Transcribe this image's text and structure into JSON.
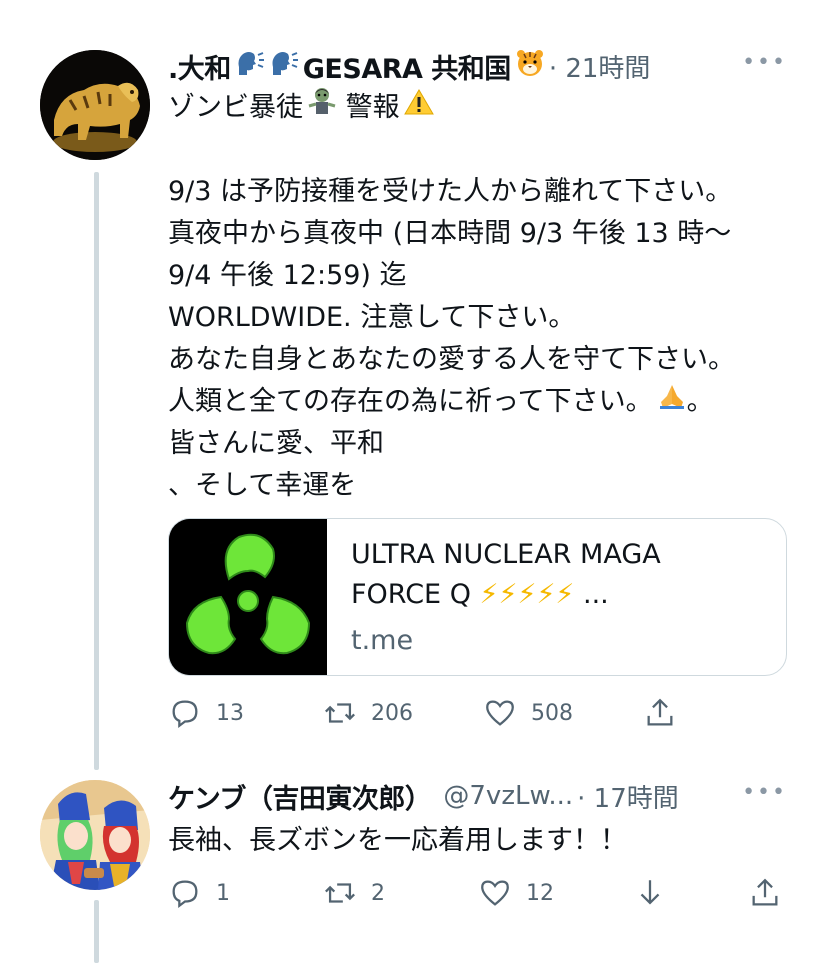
{
  "tweet1": {
    "name": ".大和",
    "name_mid": "GESARA 共和国",
    "time": "· 21時間",
    "lines": [
      "ゾンビ暴徒",
      "9/3 は予防接種を受けた人から離れて下さい。",
      "真夜中から真夜中 (日本時間 9/3 午後 13 時〜",
      "9/4 午後 12:59) 迄",
      "WORLDWIDE. 注意して下さい。",
      "あなた自身とあなたの愛する人を守て下さい。",
      "人類と全ての存在の為に祈って下さい。",
      "皆さんに愛、平和",
      "、そして幸運を"
    ],
    "line0_suffix": "警報",
    "line6_suffix": "。",
    "card": {
      "title_line1": "ULTRA NUCLEAR MAGA",
      "title_line2": "FORCE Q",
      "title_suffix": "...",
      "domain": "t.me"
    },
    "actions": {
      "replies": "13",
      "retweets": "206",
      "likes": "508"
    }
  },
  "tweet2": {
    "name": "ケンブ（吉田寅次郎）",
    "handle": "@7vzLw...",
    "time": "· 17時間",
    "text": "長袖、長ズボンを一応着用します！！",
    "actions": {
      "replies": "1",
      "retweets": "2",
      "likes": "12"
    }
  },
  "more_label": "•••",
  "icons": [
    "speaking-head-icon",
    "tiger-face-icon",
    "zombie-icon",
    "warning-icon",
    "folded-hands-icon",
    "lightning-icon",
    "reply-icon",
    "retweet-icon",
    "like-icon",
    "share-icon",
    "download-icon",
    "more-icon"
  ],
  "colors": {
    "text": "#0f1419",
    "secondary": "#536471",
    "border": "#cfd9de",
    "radioactive_green": "#6ee639",
    "bolt": "#f5b800"
  }
}
